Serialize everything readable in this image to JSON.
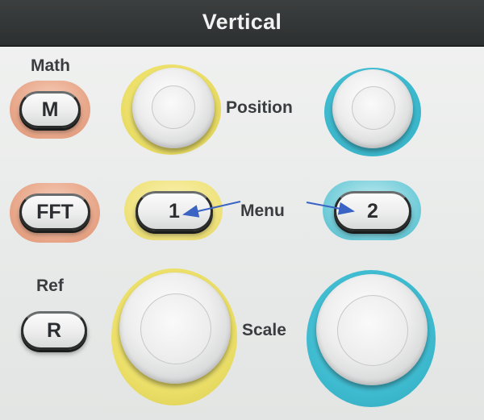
{
  "header": {
    "title": "Vertical"
  },
  "labels": {
    "math": "Math",
    "position": "Position",
    "menu": "Menu",
    "ref": "Ref",
    "scale": "Scale"
  },
  "buttons": {
    "math": "M",
    "fft": "FFT",
    "channel1": "1",
    "channel2": "2",
    "ref": "R"
  },
  "colors": {
    "channel1_accent": "#ece06a",
    "channel2_accent": "#3fbcd1",
    "math_accent": "#e7a486",
    "annotation_arrow": "#3a63c4"
  },
  "icons": {
    "position1": "rotary-knob",
    "position2": "rotary-knob",
    "scale1": "rotary-knob",
    "scale2": "rotary-knob",
    "arrows": "arrow-icon"
  }
}
